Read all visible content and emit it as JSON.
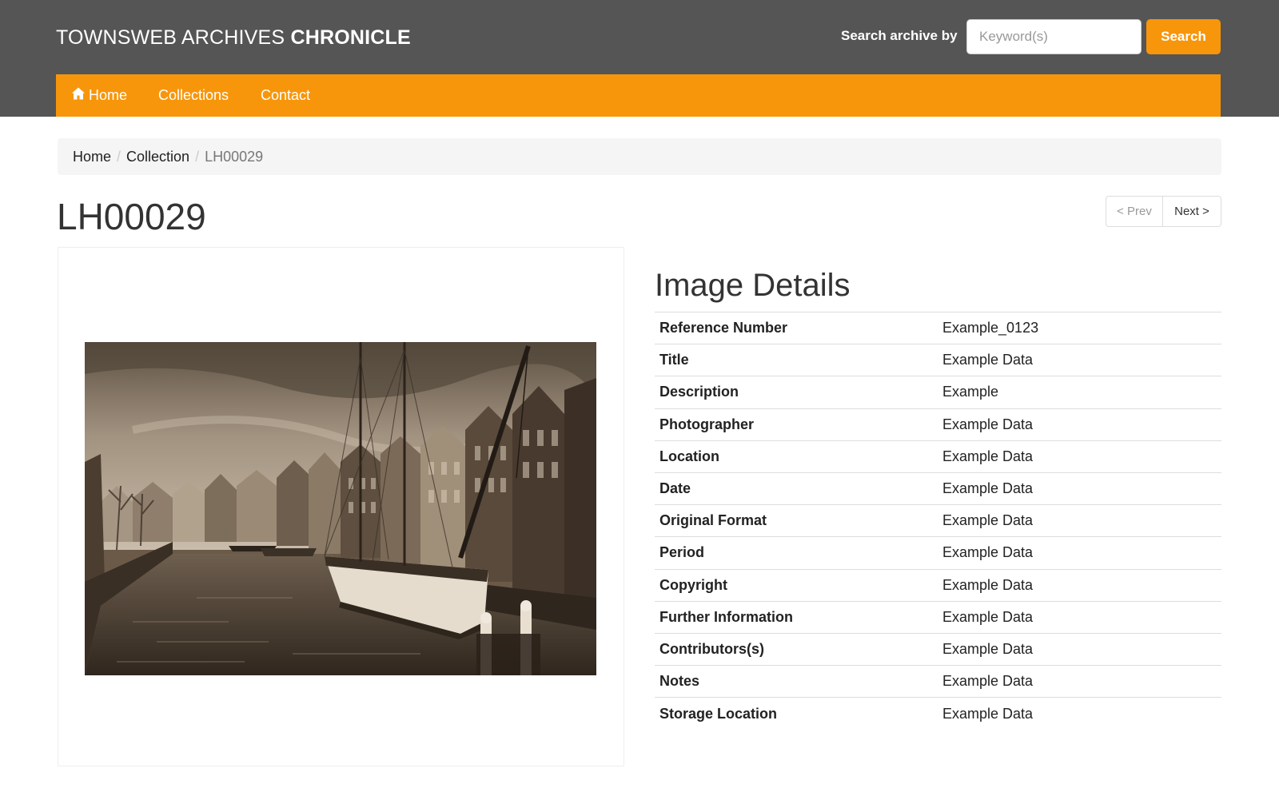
{
  "header": {
    "brand_light": "TOWNSWEB ARCHIVES ",
    "brand_bold": "CHRONICLE",
    "search_label": "Search archive by",
    "search_placeholder": "Keyword(s)",
    "search_button": "Search",
    "accent_color": "#f7960b",
    "bar_color": "#555555"
  },
  "nav": {
    "items": [
      {
        "label": "Home",
        "icon": "home-icon"
      },
      {
        "label": "Collections"
      },
      {
        "label": "Contact"
      }
    ]
  },
  "breadcrumb": {
    "items": [
      "Home",
      "Collection"
    ],
    "current": "LH00029",
    "separator": "/"
  },
  "page": {
    "title": "LH00029",
    "prev_label": "< Prev",
    "next_label": "Next >"
  },
  "details": {
    "heading": "Image Details",
    "rows": [
      {
        "label": "Reference Number",
        "value": "Example_0123"
      },
      {
        "label": "Title",
        "value": "Example Data"
      },
      {
        "label": "Description",
        "value": "Example"
      },
      {
        "label": "Photographer",
        "value": "Example Data"
      },
      {
        "label": "Location",
        "value": "Example Data"
      },
      {
        "label": "Date",
        "value": "Example Data"
      },
      {
        "label": "Original Format",
        "value": "Example Data"
      },
      {
        "label": "Period",
        "value": "Example Data"
      },
      {
        "label": "Copyright",
        "value": "Example Data"
      },
      {
        "label": "Further Information",
        "value": "Example Data"
      },
      {
        "label": "Contributors(s)",
        "value": "Example Data"
      },
      {
        "label": "Notes",
        "value": "Example Data"
      },
      {
        "label": "Storage Location",
        "value": "Example Data"
      }
    ]
  }
}
